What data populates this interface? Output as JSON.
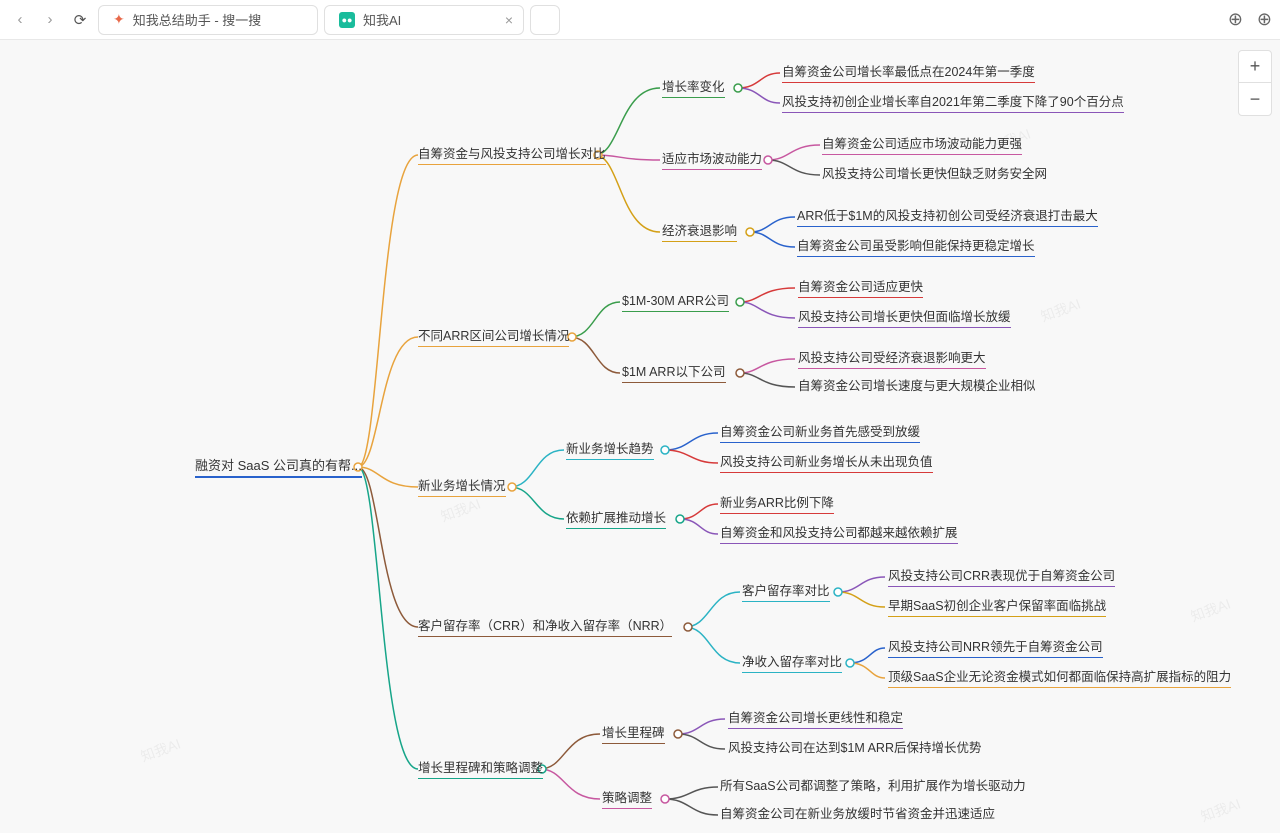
{
  "topbar": {
    "tab1": "知我总结助手 - 搜一搜",
    "tab2": "知我AI",
    "watermark": "知我AI"
  },
  "mindmap": {
    "root": "融资对 SaaS 公司真的有帮...",
    "b1": {
      "title": "自筹资金与风投支持公司增长对比",
      "s1": {
        "title": "增长率变化",
        "l1": "自筹资金公司增长率最低点在2024年第一季度",
        "l2": "风投支持初创企业增长率自2021年第二季度下降了90个百分点"
      },
      "s2": {
        "title": "适应市场波动能力",
        "l1": "自筹资金公司适应市场波动能力更强",
        "l2": "风投支持公司增长更快但缺乏财务安全网"
      },
      "s3": {
        "title": "经济衰退影响",
        "l1": "ARR低于$1M的风投支持初创公司受经济衰退打击最大",
        "l2": "自筹资金公司虽受影响但能保持更稳定增长"
      }
    },
    "b2": {
      "title": "不同ARR区间公司增长情况",
      "s1": {
        "title": "$1M-30M ARR公司",
        "l1": "自筹资金公司适应更快",
        "l2": "风投支持公司增长更快但面临增长放缓"
      },
      "s2": {
        "title": "$1M ARR以下公司",
        "l1": "风投支持公司受经济衰退影响更大",
        "l2": "自筹资金公司增长速度与更大规模企业相似"
      }
    },
    "b3": {
      "title": "新业务增长情况",
      "s1": {
        "title": "新业务增长趋势",
        "l1": "自筹资金公司新业务首先感受到放缓",
        "l2": "风投支持公司新业务增长从未出现负值"
      },
      "s2": {
        "title": "依赖扩展推动增长",
        "l1": "新业务ARR比例下降",
        "l2": "自筹资金和风投支持公司都越来越依赖扩展"
      }
    },
    "b4": {
      "title": "客户留存率（CRR）和净收入留存率（NRR）",
      "s1": {
        "title": "客户留存率对比",
        "l1": "风投支持公司CRR表现优于自筹资金公司",
        "l2": "早期SaaS初创企业客户保留率面临挑战"
      },
      "s2": {
        "title": "净收入留存率对比",
        "l1": "风投支持公司NRR领先于自筹资金公司",
        "l2": "顶级SaaS企业无论资金模式如何都面临保持高扩展指标的阻力"
      }
    },
    "b5": {
      "title": "增长里程碑和策略调整",
      "s1": {
        "title": "增长里程碑",
        "l1": "自筹资金公司增长更线性和稳定",
        "l2": "风投支持公司在达到$1M ARR后保持增长优势"
      },
      "s2": {
        "title": "策略调整",
        "l1": "所有SaaS公司都调整了策略，利用扩展作为增长驱动力",
        "l2": "自筹资金公司在新业务放缓时节省资金并迅速适应"
      }
    }
  }
}
